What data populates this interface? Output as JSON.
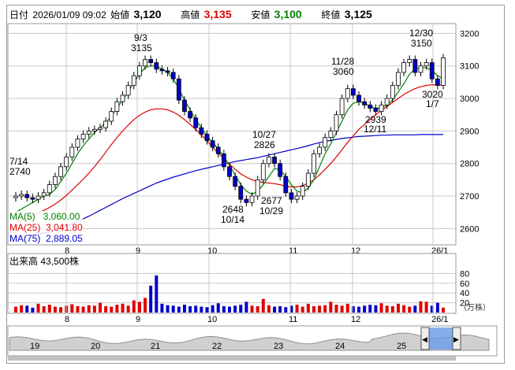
{
  "header": {
    "date_label": "日付",
    "date_value": "2026/01/09 09:02",
    "open_label": "始値",
    "open_value": "3,120",
    "high_label": "高値",
    "high_value": "3,135",
    "low_label": "安値",
    "low_value": "3,100",
    "close_label": "終値",
    "close_value": "3,125"
  },
  "legend": {
    "ma5": "MA(5)   3,060.00",
    "ma25": "MA(25)  3,041.80",
    "ma75": "MA(75)  2,889.05"
  },
  "volume": {
    "label": "出来高  43,500株",
    "unit": "（万株）",
    "yticks": [
      "80",
      "60",
      "40",
      "20"
    ]
  },
  "colors": {
    "up": "#ffffff",
    "down": "#0000cc",
    "ma5": "#008000",
    "ma25": "#e00000",
    "ma75": "#0000cc",
    "volume": "#e00000",
    "grid": "#c8c8c8"
  },
  "chart_data": [
    {
      "type": "candlestick",
      "y_ticks": [
        "3200",
        "3100",
        "3000",
        "2900",
        "2800",
        "2700",
        "2600"
      ],
      "ylim": [
        2550,
        3230
      ],
      "x_ticks": [
        "8",
        "9",
        "10",
        "11",
        "12",
        "26/1"
      ],
      "annotations": [
        {
          "label": "7/14",
          "value": "2740"
        },
        {
          "label": "9/3",
          "value": "3135"
        },
        {
          "label": "10/27",
          "value": "2826"
        },
        {
          "label": "2648",
          "value": "10/14"
        },
        {
          "label": "2677",
          "value": "10/29"
        },
        {
          "label": "11/28",
          "value": "3060"
        },
        {
          "label": "2939",
          "value": "12/11"
        },
        {
          "label": "12/30",
          "value": "3150"
        },
        {
          "label": "3020",
          "value": "1/7"
        }
      ],
      "close": [
        2700,
        2705,
        2695,
        2690,
        2700,
        2710,
        2735,
        2760,
        2790,
        2820,
        2850,
        2875,
        2890,
        2900,
        2905,
        2910,
        2930,
        2960,
        2990,
        3010,
        3040,
        3070,
        3100,
        3120,
        3110,
        3090,
        3085,
        3080,
        3060,
        2995,
        2960,
        2940,
        2910,
        2890,
        2870,
        2850,
        2830,
        2790,
        2760,
        2730,
        2690,
        2680,
        2700,
        2750,
        2800,
        2820,
        2800,
        2760,
        2710,
        2690,
        2700,
        2730,
        2770,
        2830,
        2850,
        2880,
        2900,
        2950,
        3000,
        3030,
        3010,
        2990,
        2980,
        2970,
        2960,
        2980,
        3000,
        3040,
        3080,
        3110,
        3120,
        3080,
        3100,
        3110,
        3060,
        3040,
        3125
      ],
      "ma5": [
        2650,
        2660,
        2670,
        2680,
        2690,
        2700,
        2705,
        2720,
        2745,
        2770,
        2800,
        2830,
        2855,
        2875,
        2895,
        2910,
        2925,
        2945,
        2970,
        2995,
        3020,
        3050,
        3075,
        3095,
        3100,
        3100,
        3090,
        3080,
        3060,
        3030,
        2995,
        2965,
        2935,
        2910,
        2885,
        2865,
        2845,
        2820,
        2795,
        2765,
        2735,
        2715,
        2705,
        2715,
        2735,
        2760,
        2785,
        2780,
        2760,
        2735,
        2715,
        2710,
        2725,
        2750,
        2790,
        2830,
        2860,
        2895,
        2930,
        2965,
        2985,
        2990,
        2985,
        2975,
        2970,
        2970,
        2980,
        2995,
        3020,
        3045,
        3075,
        3090,
        3095,
        3095,
        3085,
        3070,
        3060
      ],
      "ma25": [
        2620,
        2625,
        2632,
        2640,
        2648,
        2656,
        2665,
        2675,
        2688,
        2702,
        2718,
        2735,
        2752,
        2770,
        2790,
        2812,
        2835,
        2858,
        2880,
        2900,
        2918,
        2935,
        2948,
        2958,
        2965,
        2968,
        2968,
        2965,
        2958,
        2948,
        2935,
        2920,
        2905,
        2888,
        2870,
        2850,
        2832,
        2815,
        2798,
        2782,
        2768,
        2758,
        2750,
        2745,
        2742,
        2740,
        2738,
        2735,
        2730,
        2728,
        2728,
        2732,
        2740,
        2750,
        2765,
        2782,
        2800,
        2820,
        2842,
        2865,
        2885,
        2905,
        2920,
        2935,
        2950,
        2962,
        2975,
        2988,
        3000,
        3012,
        3022,
        3030,
        3036,
        3040,
        3042,
        3041,
        3042
      ],
      "ma75": [
        2575,
        2576,
        2578,
        2580,
        2583,
        2586,
        2590,
        2595,
        2601,
        2607,
        2614,
        2622,
        2630,
        2638,
        2647,
        2656,
        2665,
        2674,
        2683,
        2692,
        2700,
        2708,
        2716,
        2724,
        2732,
        2740,
        2746,
        2752,
        2758,
        2763,
        2768,
        2773,
        2778,
        2782,
        2786,
        2790,
        2794,
        2798,
        2802,
        2806,
        2809,
        2812,
        2815,
        2818,
        2822,
        2826,
        2830,
        2834,
        2838,
        2842,
        2846,
        2850,
        2855,
        2860,
        2864,
        2868,
        2871,
        2874,
        2877,
        2879,
        2881,
        2883,
        2884,
        2885,
        2886,
        2887,
        2887,
        2888,
        2888,
        2888,
        2888,
        2888,
        2889,
        2889,
        2889,
        2889,
        2889
      ],
      "ma_legend": [
        "MA(5)",
        "MA(25)",
        "MA(75)"
      ]
    },
    {
      "type": "bar",
      "name": "volume",
      "ylim": [
        0,
        100
      ],
      "values": [
        12,
        15,
        14,
        10,
        18,
        13,
        16,
        12,
        11,
        14,
        17,
        13,
        12,
        15,
        14,
        20,
        13,
        12,
        16,
        18,
        14,
        25,
        22,
        30,
        55,
        76,
        18,
        15,
        14,
        12,
        16,
        13,
        14,
        12,
        11,
        15,
        19,
        13,
        12,
        14,
        16,
        22,
        14,
        13,
        28,
        15,
        12,
        13,
        11,
        14,
        16,
        12,
        18,
        13,
        14,
        15,
        22,
        16,
        14,
        18,
        13,
        12,
        14,
        16,
        15,
        19,
        14,
        13,
        18,
        15,
        12,
        14,
        23,
        22,
        14,
        20,
        10
      ]
    }
  ],
  "overview": {
    "ticks": [
      "19",
      "20",
      "21",
      "22",
      "23",
      "24",
      "25"
    ],
    "scroll_left": "◀",
    "scroll_right": "▶"
  }
}
